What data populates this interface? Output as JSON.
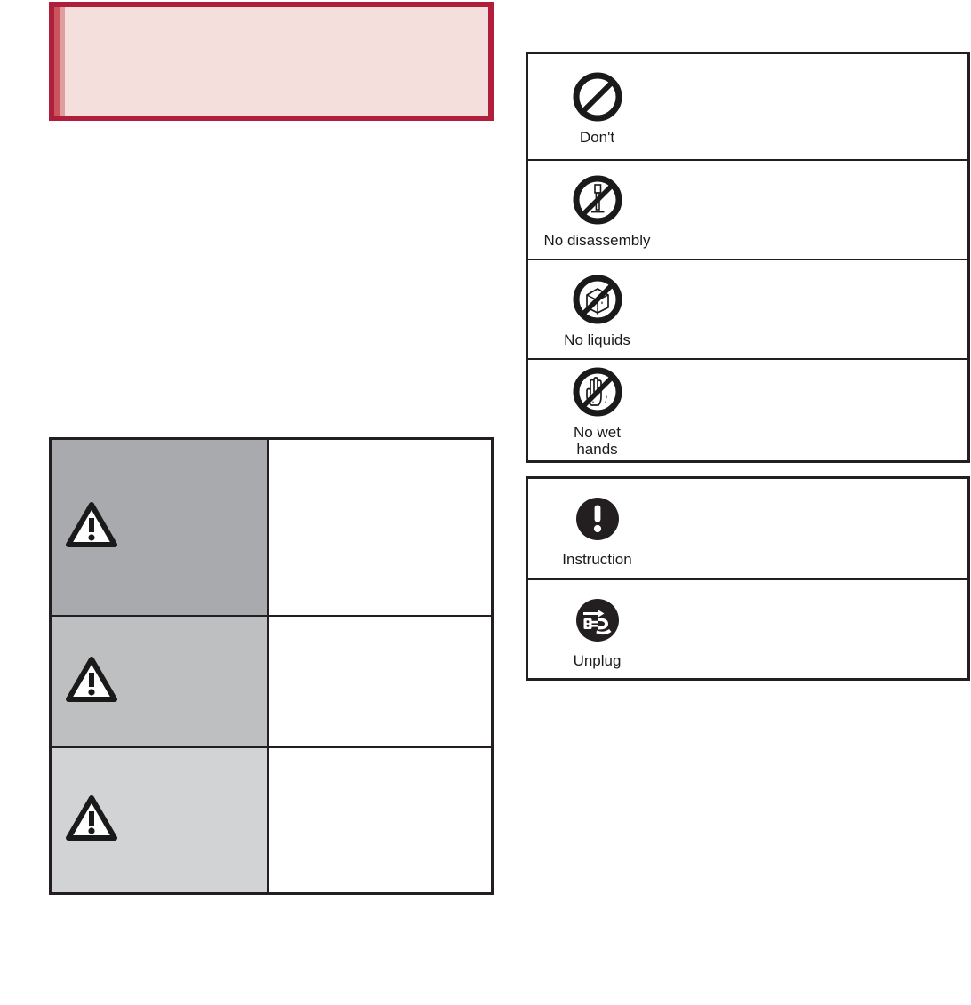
{
  "notice": {
    "text": "",
    "border_color": "#b01e3c",
    "fill_color": "#f4dfdc",
    "band_colors": [
      "#b01e3c",
      "#c9555f",
      "#df9d9d"
    ]
  },
  "alert_levels": {
    "rows": [
      {
        "icon": "warning-triangle-icon",
        "label": "",
        "description": "",
        "shade": "#a8aaad"
      },
      {
        "icon": "warning-triangle-icon",
        "label": "",
        "description": "",
        "shade": "#bdbfc1"
      },
      {
        "icon": "warning-triangle-icon",
        "label": "",
        "description": "",
        "shade": "#d1d3d4"
      }
    ]
  },
  "prohibition_symbols": {
    "rows": [
      {
        "icon": "no-entry-icon",
        "label": "Don't",
        "description": ""
      },
      {
        "icon": "no-disassembly-icon",
        "label": "No disassembly",
        "description": ""
      },
      {
        "icon": "no-liquids-icon",
        "label": "No liquids",
        "description": ""
      },
      {
        "icon": "no-wet-hands-icon",
        "label": "No wet\nhands",
        "description": ""
      }
    ]
  },
  "mandatory_symbols": {
    "rows": [
      {
        "icon": "instruction-icon",
        "label": "Instruction",
        "description": ""
      },
      {
        "icon": "unplug-icon",
        "label": "Unplug",
        "description": ""
      }
    ]
  }
}
